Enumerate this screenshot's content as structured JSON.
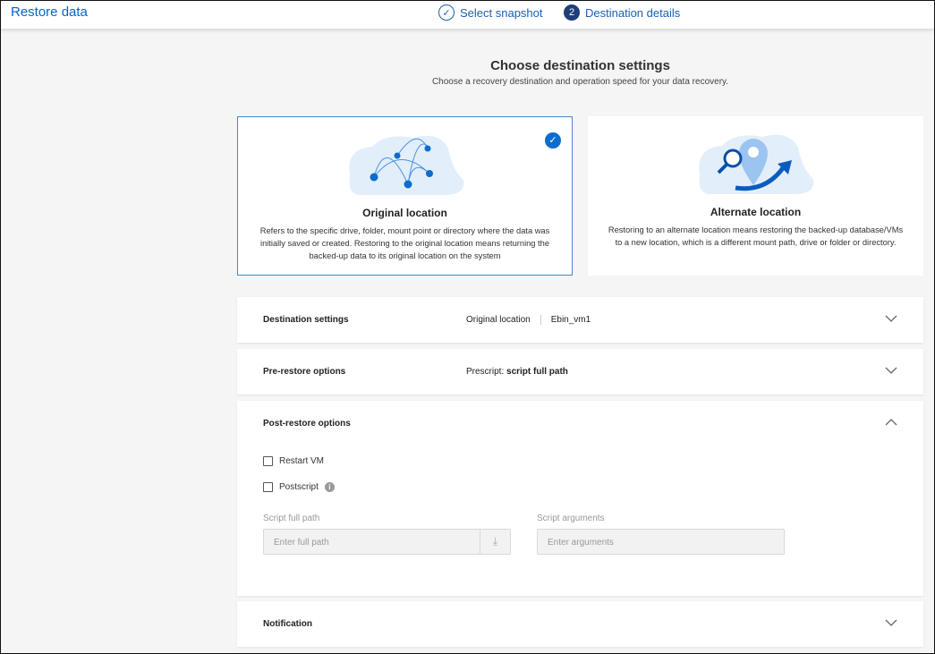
{
  "header": {
    "title": "Restore data",
    "steps": [
      {
        "label": "Select snapshot",
        "status": "done"
      },
      {
        "number": "2",
        "label": "Destination details",
        "status": "current"
      }
    ]
  },
  "main": {
    "heading": "Choose destination settings",
    "subheading": "Choose a recovery destination and operation speed for your data recovery.",
    "cards": [
      {
        "title": "Original location",
        "description": "Refers to the specific drive, folder, mount point or directory where the data was initially saved or created. Restoring to the original location means returning the backed-up data to its original location on the system",
        "selected": true
      },
      {
        "title": "Alternate location",
        "description": "Restoring to an alternate location means restoring the backed-up database/VMs to a new location, which is a different mount path, drive or folder or directory.",
        "selected": false
      }
    ],
    "panels": {
      "destination": {
        "title": "Destination settings",
        "value1": "Original location",
        "value2": "Ebin_vm1"
      },
      "prerestore": {
        "title": "Pre-restore options",
        "prefix": "Prescript:",
        "value": "script full path"
      },
      "postrestore": {
        "title": "Post-restore options",
        "restart_vm": "Restart VM",
        "postscript": "Postscript",
        "path_label": "Script full path",
        "path_placeholder": "Enter full path",
        "args_label": "Script arguments",
        "args_placeholder": "Enter arguments"
      },
      "notification": {
        "title": "Notification"
      }
    }
  },
  "colors": {
    "accent": "#0067c5",
    "step_current": "#1e3f7a"
  }
}
